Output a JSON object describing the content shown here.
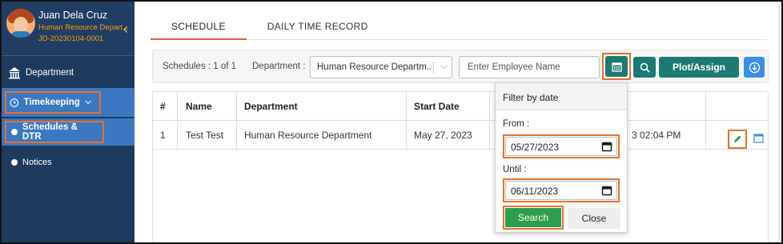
{
  "user": {
    "name": "Juan Dela Cruz",
    "department": "Human Resource Depart...",
    "employee_id": "JD-20230104-0001"
  },
  "sidebar": {
    "items": [
      {
        "label": "Department",
        "icon": "building-icon"
      },
      {
        "label": "Timekeeping",
        "icon": "clock-icon",
        "active": true
      },
      {
        "label": "Schedules & DTR",
        "active": true
      },
      {
        "label": "Notices"
      }
    ]
  },
  "tabs": [
    {
      "label": "SCHEDULE",
      "active": true
    },
    {
      "label": "DAILY TIME RECORD",
      "active": false
    }
  ],
  "toolbar": {
    "schedules_count": "Schedules : 1 of 1",
    "department_label": "Department :",
    "department_value": "Human Resource Departm...",
    "employee_placeholder": "Enter Employee Name",
    "plot_assign_label": "Plot/Assign"
  },
  "table": {
    "headers": [
      "#",
      "Name",
      "Department",
      "Start Date"
    ],
    "rows": [
      {
        "num": "1",
        "name": "Test Test",
        "department": "Human Resource Department",
        "start_date": "May 27, 2023",
        "updated": "3 02:04 PM"
      }
    ]
  },
  "filter": {
    "title": "Filter by date",
    "from_label": "From :",
    "from_value": "05/27/2023",
    "until_label": "Until :",
    "until_value": "06/11/2023",
    "search_label": "Search",
    "close_label": "Close"
  },
  "colors": {
    "sidebar_bg": "#1f3a5f",
    "sidebar_active": "#3c78c2",
    "teal_button": "#1d7a73",
    "green_button": "#2e9e4c",
    "blue_button": "#3a8ee8",
    "highlight": "#e8702a",
    "tab_underline": "#e05a47"
  }
}
